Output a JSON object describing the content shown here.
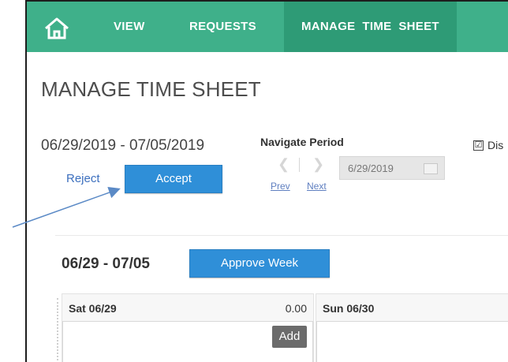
{
  "nav": {
    "items": [
      {
        "label": "VIEW"
      },
      {
        "label": "REQUESTS"
      },
      {
        "label": "MANAGE  TIME  SHEET"
      }
    ]
  },
  "page": {
    "title": "MANAGE TIME SHEET",
    "period": "06/29/2019 - 07/05/2019"
  },
  "navigate_period": {
    "label": "Navigate Period",
    "prev": "Prev",
    "next": "Next",
    "date": "6/29/2019"
  },
  "display_option": {
    "checked_mark": "☑",
    "label": "Dis"
  },
  "actions": {
    "reject": "Reject",
    "accept": "Accept"
  },
  "week": {
    "range": "06/29 - 07/05",
    "approve": "Approve Week",
    "days": [
      {
        "label": "Sat 06/29",
        "hours": "0.00",
        "add": "Add"
      },
      {
        "label": "Sun 06/30"
      }
    ]
  },
  "colors": {
    "nav_bg": "#3fb08a",
    "nav_active": "#2e9b76",
    "button_blue": "#2f8fd8",
    "annotation_arrow": "#5b8ac6"
  }
}
